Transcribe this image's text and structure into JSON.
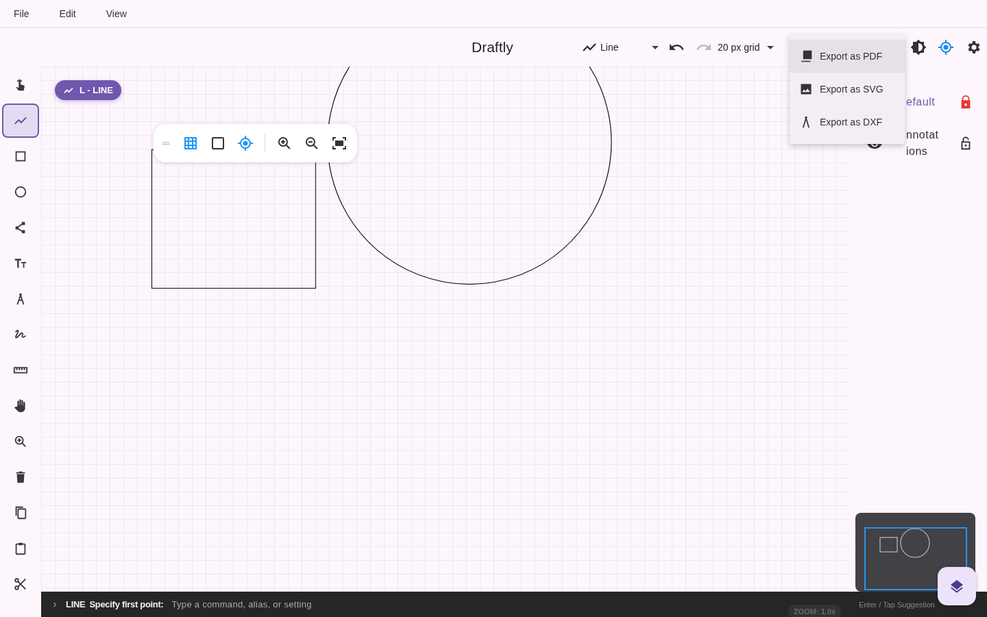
{
  "menu_bar": [
    "File",
    "Edit",
    "View"
  ],
  "header": {
    "title": "Draftly",
    "tool_select": "Line",
    "grid_select": "20 px grid"
  },
  "export_menu": [
    {
      "label": "Export as PDF",
      "selected": true
    },
    {
      "label": "Export as SVG",
      "selected": false
    },
    {
      "label": "Export as DXF",
      "selected": false
    }
  ],
  "tools": [
    {
      "selected": false
    },
    {
      "selected": true
    },
    {
      "selected": false
    },
    {
      "selected": false
    },
    {
      "selected": false
    },
    {
      "selected": false
    },
    {
      "selected": false
    },
    {
      "selected": false
    },
    {
      "selected": false
    },
    {
      "selected": false
    },
    {
      "selected": false
    },
    {
      "selected": false
    },
    {
      "selected": false
    },
    {
      "selected": false
    },
    {
      "selected": false
    }
  ],
  "command_chip": "L - LINE",
  "canvas_toolbar": [
    {
      "on": true
    },
    {
      "on": false
    },
    {
      "on": true
    }
  ],
  "layers": [
    {
      "name": "efault",
      "selected": true,
      "locked": true
    },
    {
      "name": "nnotations",
      "selected": false,
      "locked": false
    }
  ],
  "zoom_badge": "ZOOM: 1.0x",
  "command_line": {
    "command": "LINE",
    "prompt": "Specify first point:",
    "placeholder": "Type a command, alias, or setting",
    "hint": "Enter / Tap Suggestion"
  }
}
